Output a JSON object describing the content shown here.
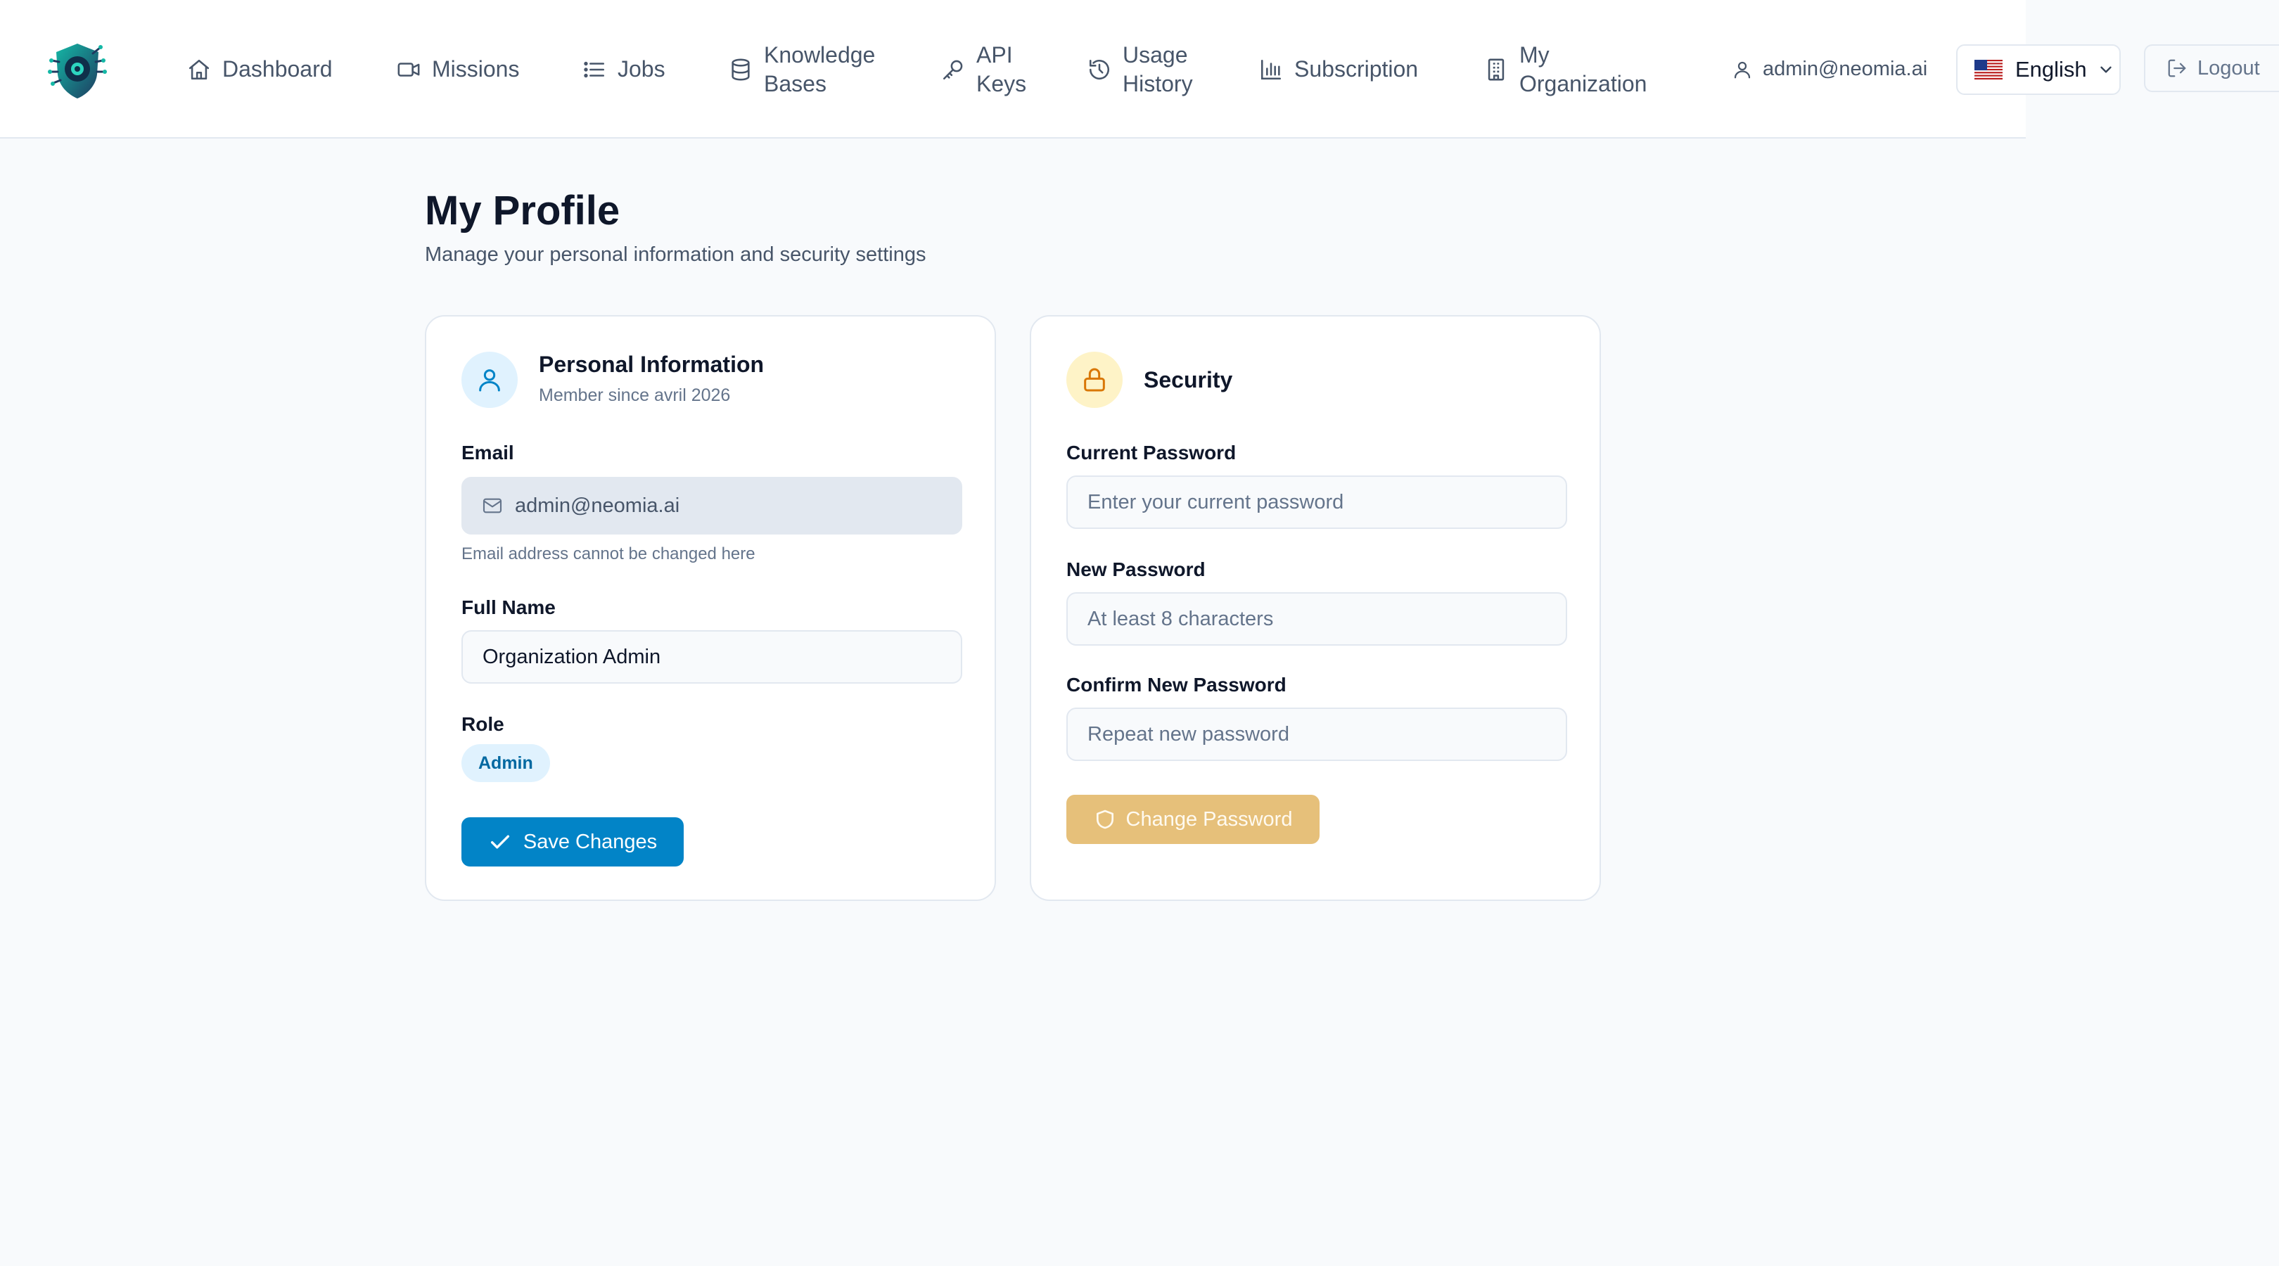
{
  "header": {
    "logo_icon": "shield-brain-logo",
    "nav": [
      {
        "icon": "home-icon",
        "label": "Dashboard"
      },
      {
        "icon": "video-icon",
        "label": "Missions"
      },
      {
        "icon": "list-icon",
        "label": "Jobs"
      },
      {
        "icon": "database-icon",
        "label": "Knowledge Bases"
      },
      {
        "icon": "key-icon",
        "label": "API Keys"
      },
      {
        "icon": "history-icon",
        "label": "Usage History"
      },
      {
        "icon": "bar-chart-icon",
        "label": "Subscription"
      },
      {
        "icon": "building-icon",
        "label": "My Organization"
      }
    ],
    "user_email": "admin@neomia.ai",
    "language": "English",
    "logout_label": "Logout"
  },
  "page": {
    "title": "My Profile",
    "subtitle": "Manage your personal information and security settings"
  },
  "personal": {
    "title": "Personal Information",
    "subtitle": "Member since avril 2026",
    "email_label": "Email",
    "email_value": "admin@neomia.ai",
    "email_helper": "Email address cannot be changed here",
    "fullname_label": "Full Name",
    "fullname_value": "Organization Admin",
    "role_label": "Role",
    "role_value": "Admin",
    "save_label": "Save Changes"
  },
  "security": {
    "title": "Security",
    "current_label": "Current Password",
    "current_placeholder": "Enter your current password",
    "new_label": "New Password",
    "new_placeholder": "At least 8 characters",
    "confirm_label": "Confirm New Password",
    "confirm_placeholder": "Repeat new password",
    "change_label": "Change Password"
  },
  "colors": {
    "primary": "#0284c7",
    "warning_button": "#e6c07a",
    "background": "#f8fafc"
  }
}
